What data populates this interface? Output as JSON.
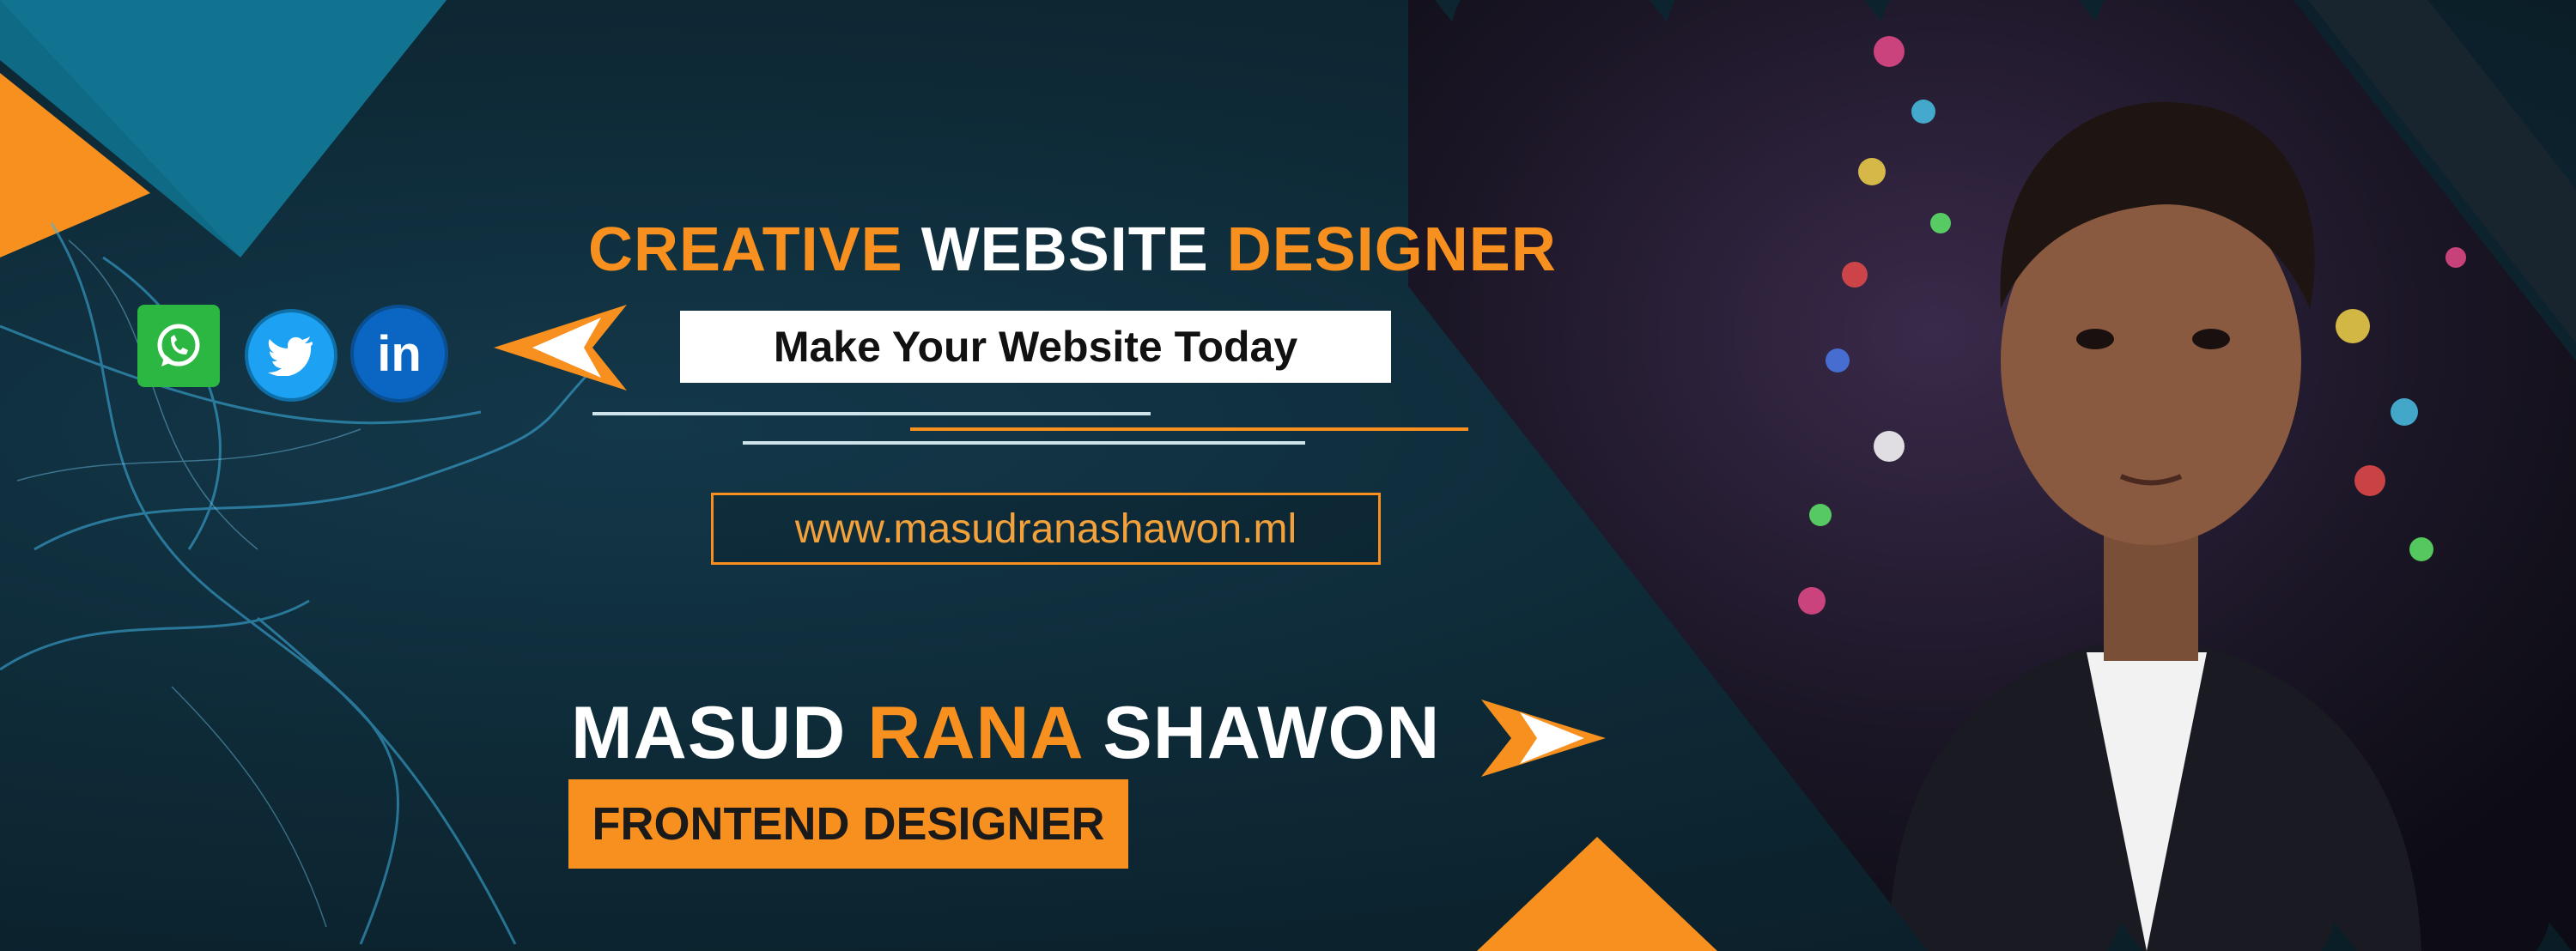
{
  "headline": {
    "part1": "CREATIVE",
    "part2": "WEBSITE",
    "part3": "DESIGNER"
  },
  "tagline": "Make Your Website Today",
  "website": "www.masudranashawon.ml",
  "name": {
    "first": "MASUD",
    "middle": "RANA",
    "last": "SHAWON"
  },
  "role": "FRONTEND DESIGNER",
  "social_icons": [
    "whatsapp-icon",
    "twitter-icon",
    "linkedin-icon"
  ],
  "colors": {
    "accent": "#f7901e",
    "background": "#0d2530",
    "teal": "#0f6a86",
    "white": "#ffffff"
  }
}
